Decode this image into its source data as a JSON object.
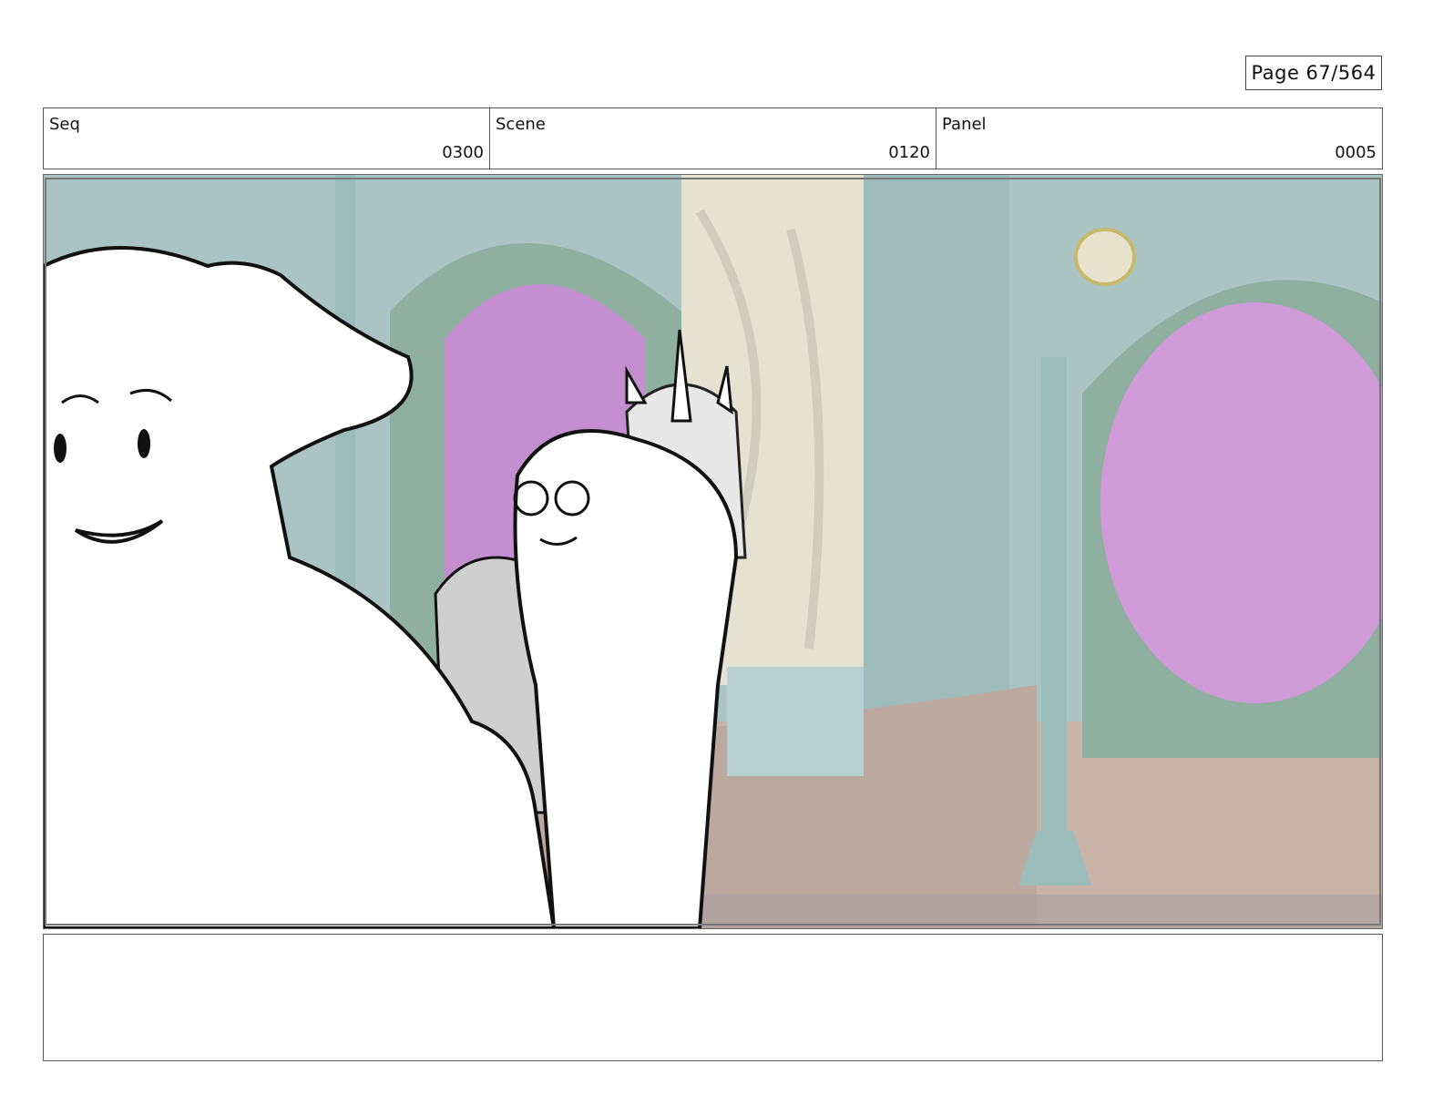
{
  "page": {
    "label": "Page",
    "current": "67",
    "total": "564",
    "text": "Page  67/564"
  },
  "header": {
    "seq": {
      "label": "Seq",
      "value": "0300"
    },
    "scene": {
      "label": "Scene",
      "value": "0120"
    },
    "panel": {
      "label": "Panel",
      "value": "0005"
    }
  },
  "notes": {
    "text": ""
  },
  "colors": {
    "wall_teal": "#a9c4c2",
    "arch_purple": "#c48ed0",
    "floor": "#c7b3a8",
    "cream": "#e6e2d2",
    "line": "#111111"
  }
}
